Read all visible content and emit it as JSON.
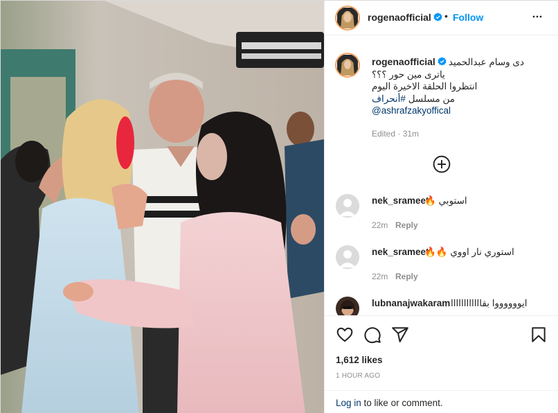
{
  "post": {
    "author": "rogenaofficial",
    "follow_label": "Follow",
    "separator": "•",
    "caption_lines": [
      "دى وسام عبدالحميد",
      "ياترى مين حور ؟؟؟",
      "انتظروا الحلقة الاخيرة اليوم",
      "من مسلسل"
    ],
    "hashtag": "#أنحراف",
    "mention": "@ashrafzakyoffical",
    "edited": "Edited",
    "edited_sep": " · ",
    "edited_time": "31m",
    "likes": "1,612 likes",
    "time_ago": "1 hour ago"
  },
  "comments": [
    {
      "user": "nek_srameet",
      "text": "استوبي 🔥",
      "time": "22m",
      "reply": "Reply"
    },
    {
      "user": "nek_srameet",
      "text": "استوري نار اووي 🔥🔥",
      "time": "22m",
      "reply": "Reply"
    },
    {
      "user": "lubnanajwakaram",
      "text": "ايووووووا بقاااااااااااا",
      "time": "",
      "reply": ""
    }
  ],
  "footer": {
    "login": "Log in",
    "rest": " to like or comment."
  },
  "colors": {
    "accent": "#0095f6",
    "link": "#00376b",
    "muted": "#8e8e8e",
    "ring": "#f4a261"
  },
  "icons": [
    "verified-badge-icon",
    "more-options-icon",
    "add-comment-icon",
    "heart-icon",
    "comment-icon",
    "share-icon",
    "bookmark-icon"
  ]
}
